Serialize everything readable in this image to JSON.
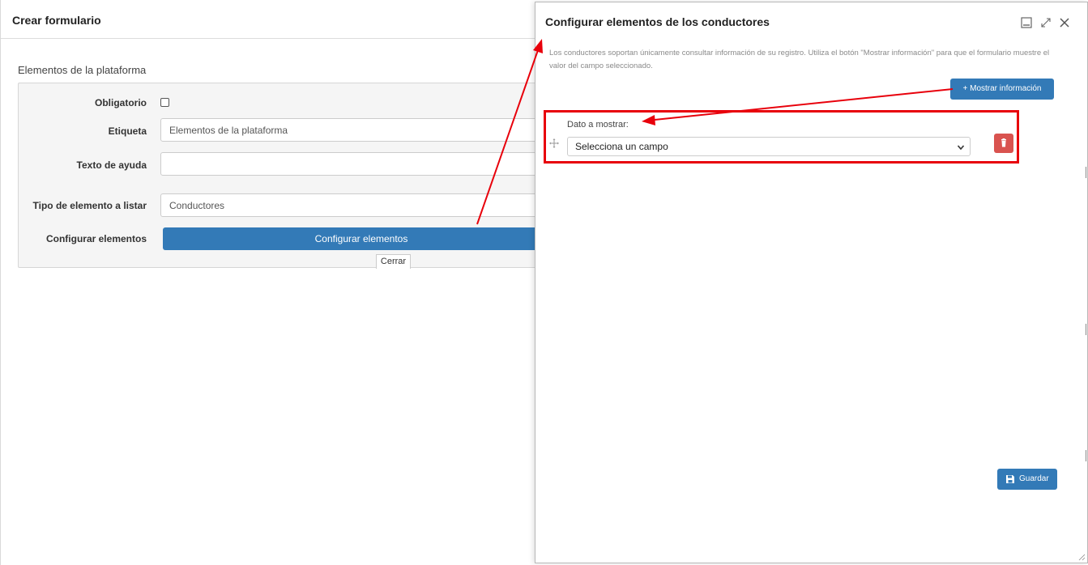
{
  "left_dialog": {
    "title": "Crear formulario",
    "section_title": "Elementos de la plataforma",
    "fields": {
      "required_label": "Obligatorio",
      "label_label": "Etiqueta",
      "label_value": "Elementos de la plataforma",
      "help_label": "Texto de ayuda",
      "help_value": "",
      "type_label": "Tipo de elemento a listar",
      "type_value": "Conductores",
      "config_label": "Configurar elementos",
      "config_button": "Configurar elementos"
    },
    "close_label": "Cerrar"
  },
  "right_dialog": {
    "title": "Configurar elementos de los conductores",
    "description": "Los conductores soportan únicamente consultar información de su registro. Utiliza el botón \"Mostrar información\" para que el formulario muestre el valor del campo seleccionado.",
    "show_info_button": "Mostrar información",
    "field_label": "Dato a mostrar:",
    "select_value": "Selecciona un campo",
    "save_button": "Guardar",
    "icons": [
      "minimize-icon",
      "expand-icon",
      "close-icon",
      "move-icon",
      "trash-icon",
      "save-icon",
      "plus-icon"
    ]
  },
  "colors": {
    "primary": "#337ab7",
    "danger": "#d9534f",
    "annotation": "#e8000b"
  }
}
